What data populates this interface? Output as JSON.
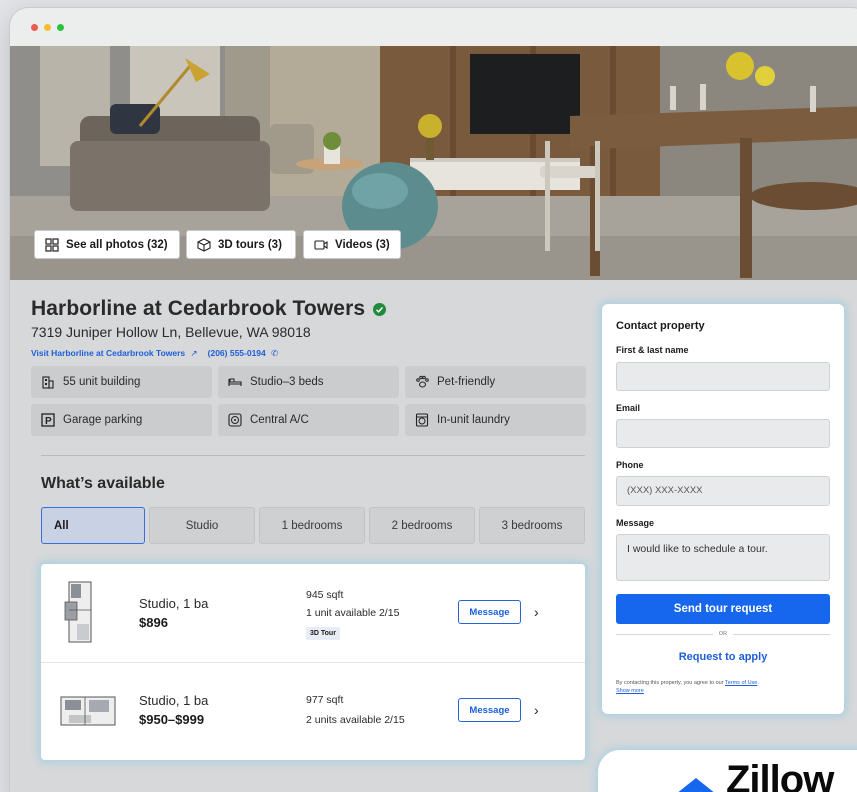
{
  "hero": {
    "buttons": [
      {
        "label": "See all photos (32)",
        "icon": "grid-icon"
      },
      {
        "label": "3D tours (3)",
        "icon": "cube-icon"
      },
      {
        "label": "Videos (3)",
        "icon": "video-icon"
      }
    ]
  },
  "property": {
    "name": "Harborline at Cedarbrook Towers",
    "verified_icon": "check-badge-icon",
    "address": "7319 Juniper Hollow Ln, Bellevue, WA 98018",
    "website_link": "Visit Harborline at Cedarbrook Towers",
    "phone": "(206) 555-0194"
  },
  "amenities": [
    {
      "label": "55 unit building",
      "icon": "building-icon"
    },
    {
      "label": "Studio–3 beds",
      "icon": "bed-icon"
    },
    {
      "label": "Pet-friendly",
      "icon": "paw-icon"
    },
    {
      "label": "Garage parking",
      "icon": "parking-icon"
    },
    {
      "label": "Central A/C",
      "icon": "fan-icon"
    },
    {
      "label": "In-unit laundry",
      "icon": "washer-icon"
    }
  ],
  "availability": {
    "title": "What’s available",
    "filters": [
      "All",
      "Studio",
      "1 bedrooms",
      "2 bedrooms",
      "3 bedrooms"
    ],
    "active_filter": "All",
    "units": [
      {
        "type": "Studio, 1 ba",
        "price": "$896",
        "sqft": "945 sqft",
        "availability": "1 unit available 2/15",
        "badge": "3D Tour",
        "button": "Message"
      },
      {
        "type": "Studio, 1 ba",
        "price": "$950–$999",
        "sqft": "977 sqft",
        "availability": "2 units available 2/15",
        "badge": "",
        "button": "Message"
      }
    ]
  },
  "contact": {
    "title": "Contact property",
    "name_label": "First & last name",
    "email_label": "Email",
    "phone_label": "Phone",
    "phone_placeholder": "(XXX) XXX-XXXX",
    "message_label": "Message",
    "message_value": "I would like to schedule a tour.",
    "send_button": "Send tour request",
    "or_text": "OR",
    "apply_link": "Request to apply",
    "legal_text": "By contacting this property, you agree to our",
    "terms_link": "Terms of Use",
    "show_more": "Show more"
  },
  "brand": {
    "logo_text": "Zillow",
    "accent_color": "#1766ee"
  }
}
